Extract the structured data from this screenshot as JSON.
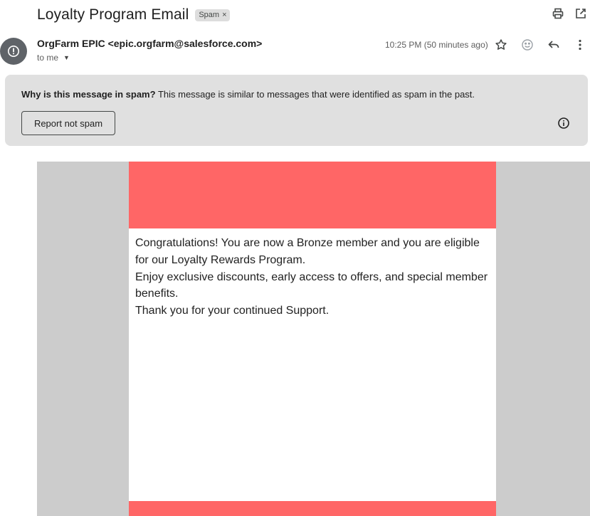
{
  "email": {
    "subject": "Loyalty Program Email",
    "label": "Spam",
    "label_remove": "×",
    "sender": "OrgFarm EPIC <epic.orgfarm@salesforce.com>",
    "recipient": "to me",
    "timestamp": "10:25 PM (50 minutes ago)"
  },
  "spam_notice": {
    "question": "Why is this message in spam?",
    "explanation": " This message is similar to messages that were identified as spam in the past.",
    "button_label": "Report not spam"
  },
  "content": {
    "line1": "Congratulations! You are now a Bronze member and you are eligible for our Loyalty Rewards Program.",
    "line2": "Enjoy exclusive discounts, early access to offers, and special member benefits.",
    "line3": "Thank you for your continued Support."
  },
  "colors": {
    "banner": "#ff6666",
    "body_background": "#cccccc",
    "spam_box": "#e0e0e0",
    "avatar": "#5f6368"
  },
  "icons": {
    "top": [
      "print-icon",
      "open-in-new-window-icon"
    ],
    "message": [
      "star-icon",
      "emoji-reaction-icon",
      "reply-icon",
      "more-options-icon"
    ],
    "avatar": "spam-warning-icon",
    "spam_info": "info-icon"
  }
}
